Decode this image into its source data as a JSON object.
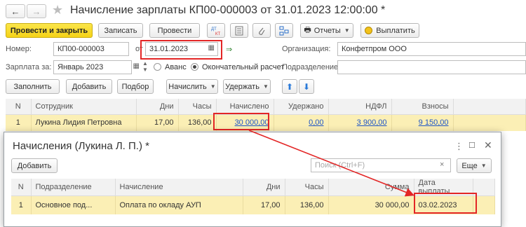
{
  "window": {
    "title": "Начисление зарплаты КП00-000003 от 31.01.2023 12:00:00 *"
  },
  "toolbar": {
    "post_close": "Провести и закрыть",
    "save": "Записать",
    "post": "Провести",
    "reports": "Отчеты",
    "payouts": "Выплатить"
  },
  "form": {
    "number_label": "Номер:",
    "number_value": "КП00-000003",
    "date_label": "от",
    "date_value": "31.01.2023",
    "org_label": "Организация:",
    "org_value": "Конфетпром ООО",
    "salary_for_label": "Зарплата за:",
    "salary_for_value": "Январь 2023",
    "advance_label": "Аванс",
    "final_label": "Окончательный расчет",
    "dept_label": "Подразделение:",
    "dept_value": ""
  },
  "actions": {
    "fill": "Заполнить",
    "add": "Добавить",
    "select": "Подбор",
    "accrue": "Начислить",
    "withhold": "Удержать"
  },
  "main_table": {
    "headers": [
      "N",
      "Сотрудник",
      "Дни",
      "Часы",
      "Начислено",
      "Удержано",
      "НДФЛ",
      "Взносы"
    ],
    "rows": [
      {
        "n": "1",
        "employee": "Лукина Лидия Петровна",
        "days": "17,00",
        "hours": "136,00",
        "accrued": "30 000,00",
        "withheld": "0,00",
        "ndfl": "3 900,00",
        "contrib": "9 150,00"
      }
    ]
  },
  "dialog": {
    "title": "Начисления (Лукина Л. П.) *",
    "add": "Добавить",
    "search_placeholder": "Поиск (Ctrl+F)",
    "more": "Еще",
    "headers": [
      "N",
      "Подразделение",
      "Начисление",
      "Дни",
      "Часы",
      "Сумма",
      "Дата выплаты"
    ],
    "rows": [
      {
        "n": "1",
        "dept": "Основное под...",
        "accrual": "Оплата по окладу АУП",
        "days": "17,00",
        "hours": "136,00",
        "sum": "30 000,00",
        "pay_date": "03.02.2023"
      }
    ]
  },
  "icons": [
    "back-arrow-icon",
    "forward-arrow-icon",
    "star-icon",
    "dt-kt-icon",
    "list-icon",
    "attach-icon",
    "structure-icon",
    "printer-icon",
    "coin-icon",
    "calendar-icon",
    "up-arrow-icon",
    "down-arrow-icon",
    "more-icon",
    "maximize-icon",
    "close-icon"
  ],
  "colors": {
    "accent_yellow": "#f5d217",
    "selected_row": "#fbefb5",
    "highlight_red": "#e32626",
    "link_blue": "#1e55c7"
  }
}
